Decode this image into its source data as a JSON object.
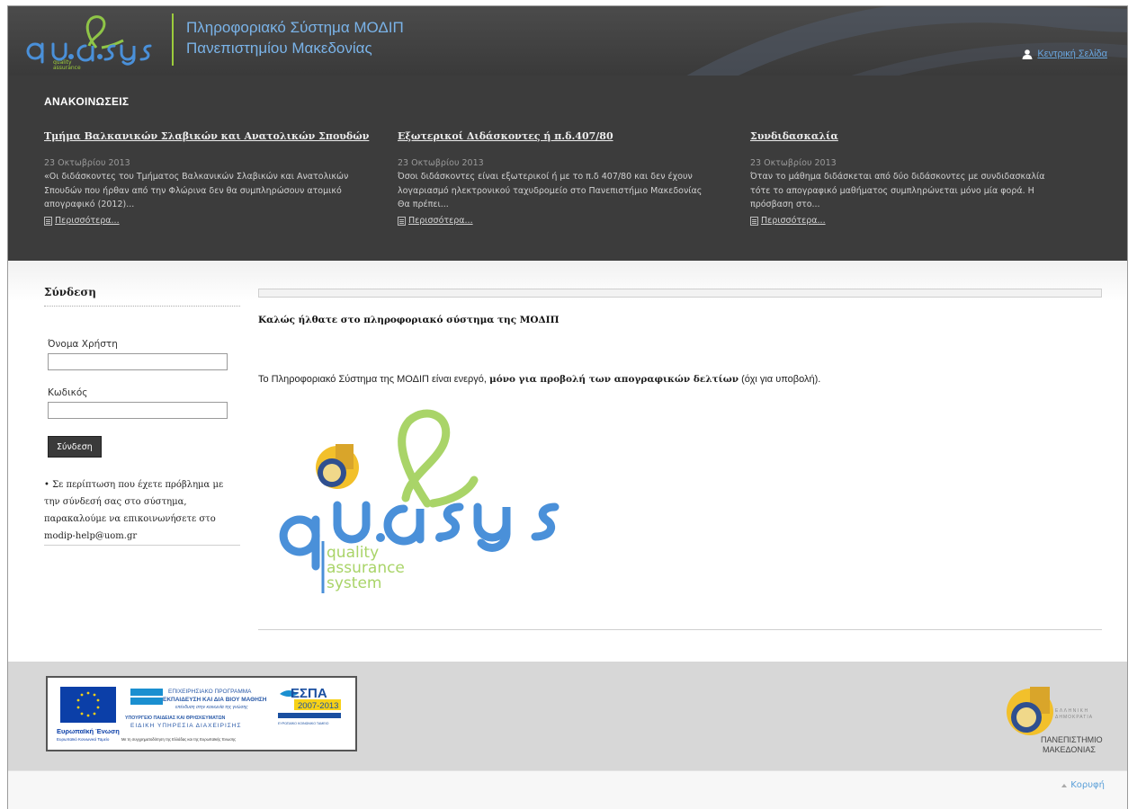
{
  "header": {
    "logo_text": "qu.a.sys",
    "logo_tagline": [
      "quality",
      "assurance",
      "system"
    ],
    "title_line1": "Πληροφοριακό Σύστημα ΜΟΔΙΠ",
    "title_line2": "Πανεπιστημίου Μακεδονίας",
    "home_link": "Κεντρική Σελίδα",
    "home_icon": "user-icon"
  },
  "announcements": {
    "heading": "ΑΝΑΚΟΙΝΩΣΕΙΣ",
    "more_label": "Περισσότερα...",
    "items": [
      {
        "title": "Τμήμα Βαλκανικών Σλαβικών και Ανατολικών Σπουδών",
        "date": "23 Οκτωβρίου 2013",
        "lines": [
          "«Οι διδάσκοντες του Τμήματος Βαλκανικών Σλαβικών και Ανατολικών",
          "Σπουδών που ήρθαν από την Φλώρινα δεν θα συμπληρώσουν ατομικό",
          "απογραφικό (2012)..."
        ]
      },
      {
        "title": "Εξωτερικοί Διδάσκοντες ή π.δ.407/80",
        "date": "23 Οκτωβρίου 2013",
        "lines": [
          "Όσοι διδάσκοντες είναι εξωτερικοί ή με το π.δ 407/80 και δεν έχουν",
          "λογαριασμό ηλεκτρονικού ταχυδρομείο στο Πανεπιστήμιο Μακεδονίας",
          "Θα πρέπει..."
        ]
      },
      {
        "title": "Συνδιδασκαλία",
        "date": "23 Οκτωβρίου 2013",
        "lines": [
          "Όταν το μάθημα διδάσκεται από δύο διδάσκοντες με συνδιδασκαλία",
          "τότε το απογραφικό μαθήματος συμπληρώνεται μόνο μία φορά. Η",
          "πρόσβαση στο..."
        ]
      }
    ]
  },
  "login": {
    "heading": "Σύνδεση",
    "username_label": "Όνομα Χρήστη",
    "username_value": "",
    "password_label": "Κωδικός",
    "password_value": "",
    "submit_label": "Σύνδεση",
    "help_lines": [
      "• Σε περίπτωση που έχετε πρόβλημα με",
      "την σύνδεσή σας στο σύστημα,",
      "παρακαλούμε να επικοινωνήσετε στο",
      "modip-help@uom.gr"
    ]
  },
  "content": {
    "welcome": "Καλώς ήλθατε στο πληροφοριακό σύστημα της ΜΟΔΙΠ",
    "notice_prefix": "Το Πληροφοριακό Σύστημα της ΜΟΔΙΠ είναι ενεργό, ",
    "notice_bold": "μόνο για προβολή των απογραφικών δελτίων",
    "notice_suffix": " (όχι για υποβολή)."
  },
  "footer": {
    "eu_label": "Ευρωπαϊκή Ένωση",
    "eu_sublabel": "Ευρωπαϊκό Κοινωνικό Ταμείο",
    "program_line1": "ΕΠΙΧΕΙΡΗΣΙΑΚΟ ΠΡΟΓΡΑΜΜΑ",
    "program_line2": "ΕΚΠΑΙΔΕΥΣΗ ΚΑΙ ΔΙΑ ΒΙΟΥ ΜΑΘΗΣΗ",
    "program_line3": "επένδυση στην κοινωνία της γνώσης",
    "ministry_line1": "ΥΠΟΥΡΓΕΙΟ ΠΑΙΔΕΙΑΣ ΚΑΙ ΘΡΗΣΚΕΥΜΑΤΩΝ",
    "ministry_line2": "ΕΙΔΙΚΗ ΥΠΗΡΕΣΙΑ ΔΙΑΧΕΙΡΙΣΗΣ",
    "cofund_line": "Με τη συγχρηματοδότηση της Ελλάδας και της Ευρωπαϊκής Ένωσης",
    "espa_label": "ΕΣΠΑ",
    "espa_years": "2007-2013",
    "espa_sub": "ΕΥΡΩΠΑΪΚΟ ΚΟΙΝΩΝΙΚΟ ΤΑΜΕΙΟ",
    "uom_line1": "ΠΑΝΕΠΙΣΤΗΜΙΟ",
    "uom_line2": "ΜΑΚΕΔΟΝΙΑΣ",
    "uom_small1": "ΕΛΛΗΝΙΚΗ",
    "uom_small2": "ΔΗΜΟΚΡΑΤΙΑ",
    "top_link": "Κορυφή"
  },
  "colors": {
    "header_bg": "#3a3a3a",
    "announcement_bg": "#3c3c3c",
    "accent_blue": "#4a90d9",
    "accent_green": "#9ccc3c",
    "link_blue": "#5a9fd8"
  }
}
